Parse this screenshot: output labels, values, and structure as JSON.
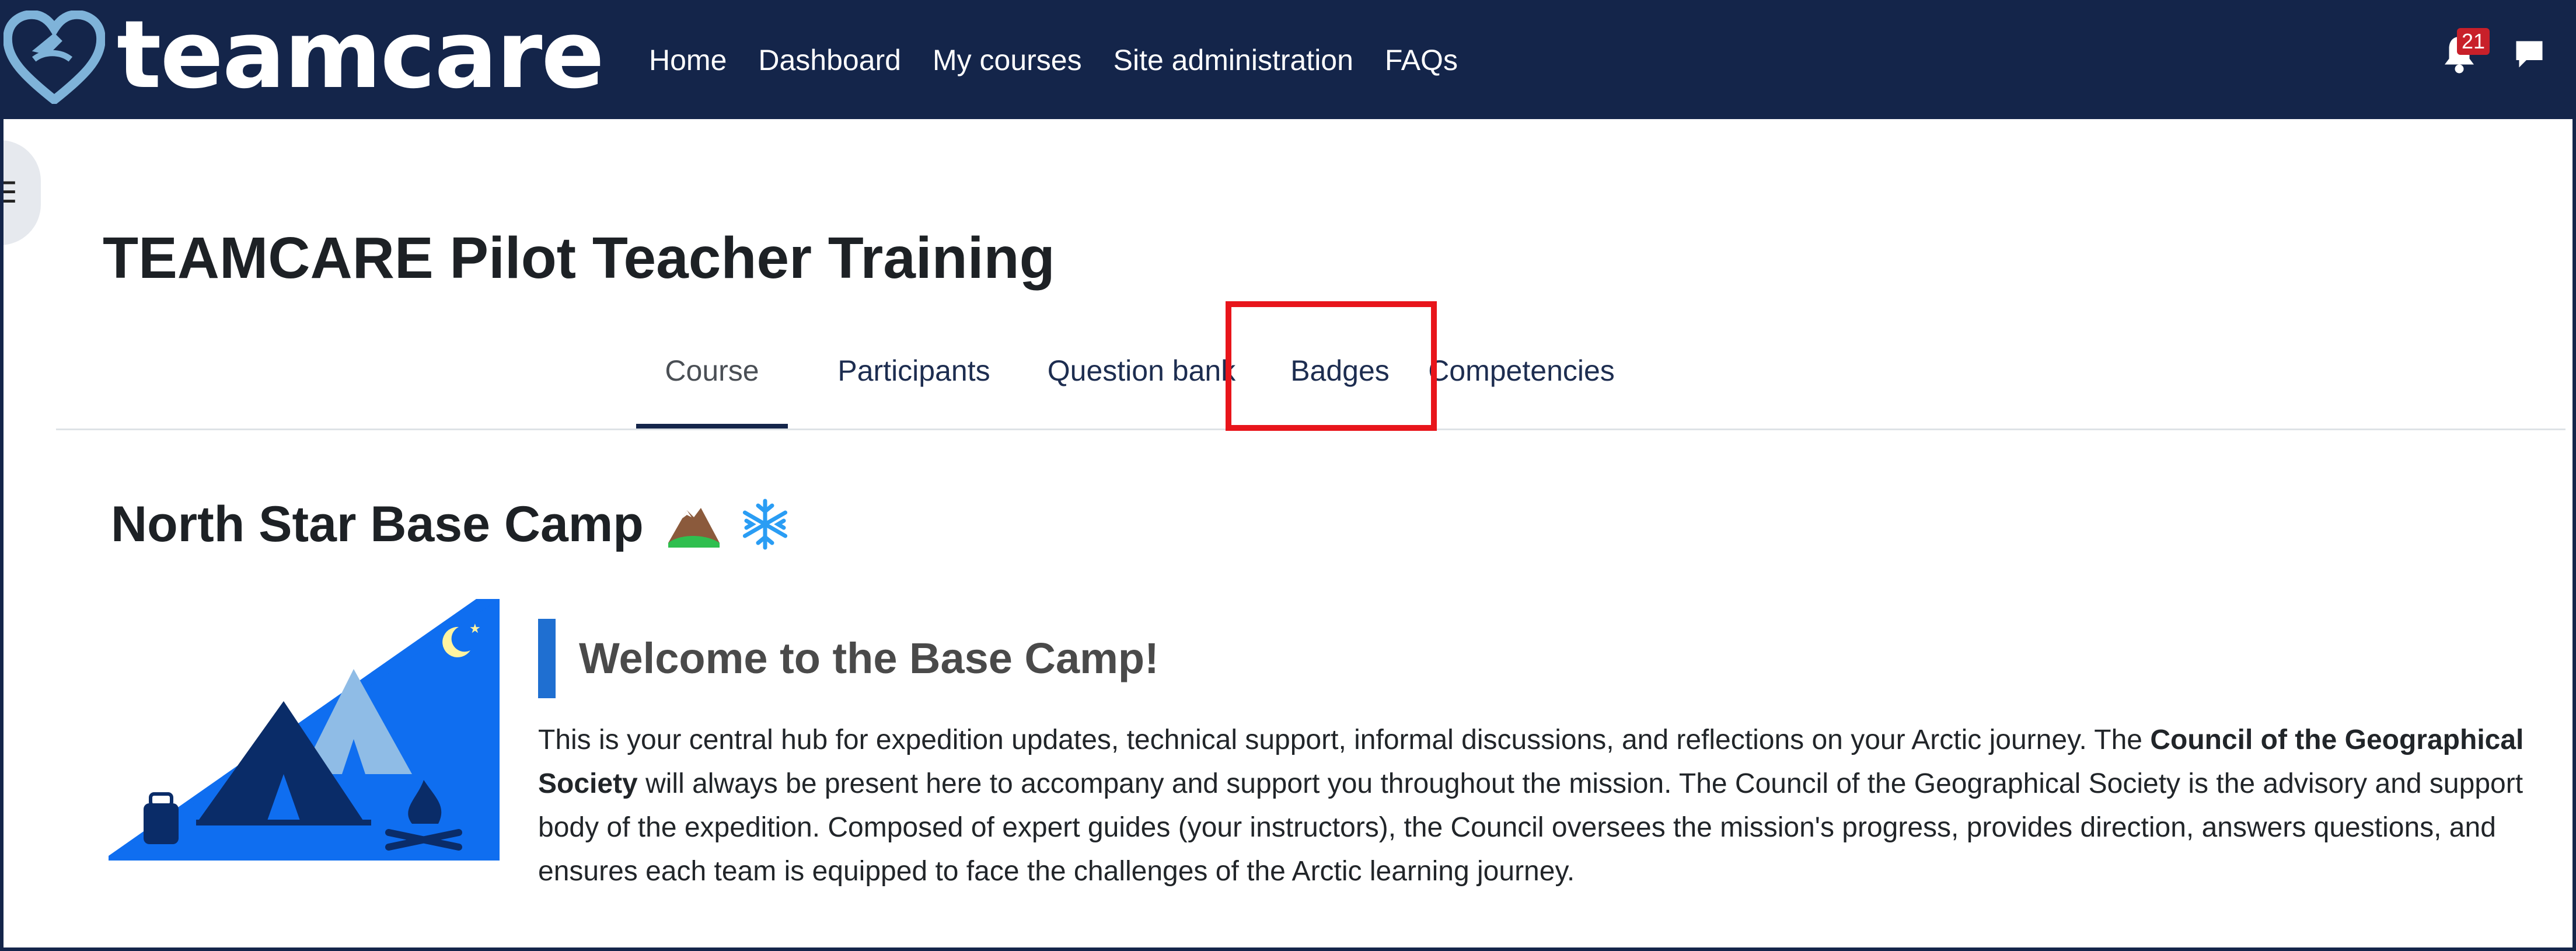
{
  "brand": {
    "name": "teamcare"
  },
  "nav": {
    "links": [
      "Home",
      "Dashboard",
      "My courses",
      "Site administration",
      "FAQs"
    ],
    "notification_count": "21"
  },
  "course": {
    "title": "TEAMCARE Pilot Teacher Training",
    "tabs": [
      "Course",
      "Participants",
      "Question bank",
      "Badges",
      "Competencies"
    ],
    "active_tab": "Course",
    "highlighted_tab": "Badges"
  },
  "section": {
    "title": "North Star Base Camp",
    "icons": [
      "mountain-icon",
      "snowflake-icon"
    ],
    "welcome_heading": "Welcome to the Base Camp!",
    "para_1": "This is your central hub for expedition updates, technical support, informal discussions, and reflections on your Arctic journey. The ",
    "para_bold": "Council of the Geographical Society",
    "para_2": " will always be present here to accompany and support you throughout the mission. The Council of the Geographical Society is the advisory and support body of the expedition. Composed of expert guides (your instructors), the Council oversees the mission's progress, provides direction, answers questions, and ensures each team is equipped to face the challenges of the Arctic learning journey."
  },
  "colors": {
    "navbar": "#14254a",
    "highlight": "#e8151b",
    "accent_bar": "#1f6fd1",
    "image_bg": "#0f6ef0"
  }
}
